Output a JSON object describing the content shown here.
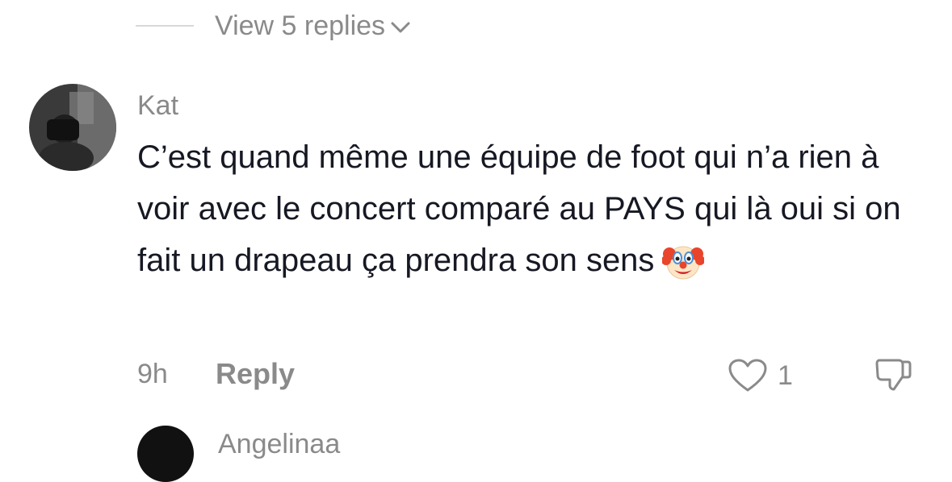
{
  "replies_toggle": {
    "label": "View 5 replies",
    "icon": "chevron-down-icon"
  },
  "comment": {
    "author": "Kat",
    "text": "C’est quand même une équipe de foot qui n’a rien à voir avec le concert comparé au PAYS qui là oui si on fait un drapeau ça prendra son sens",
    "emoji": "🤡",
    "time": "9h",
    "reply_label": "Reply",
    "like_count": "1",
    "like_icon": "heart-outline-icon",
    "dislike_icon": "thumbs-down-icon"
  },
  "next_comment": {
    "author": "Angelinaa"
  },
  "colors": {
    "text_primary": "#161823",
    "text_secondary": "#8a8a8a",
    "divider": "#d8d8d8",
    "background": "#ffffff"
  }
}
